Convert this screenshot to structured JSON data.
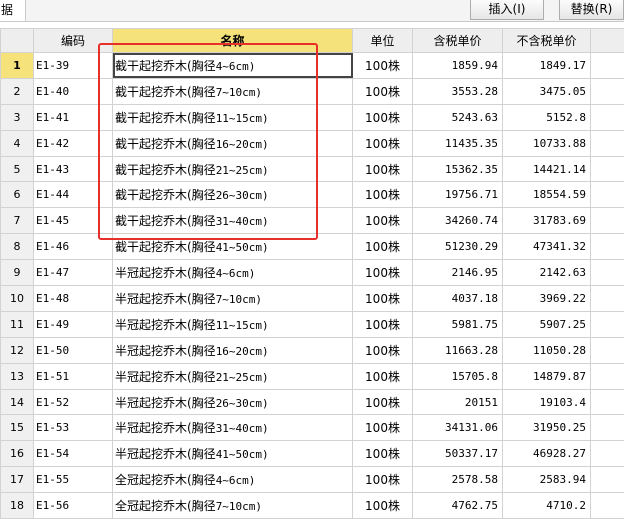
{
  "toolbar": {
    "tab_label": "据",
    "insert_label": "插入(I)",
    "replace_label": "替换(R)"
  },
  "columns": {
    "code": "编码",
    "name": "名称",
    "unit": "单位",
    "price_tax": "含税单价",
    "price_notax": "不含税单价"
  },
  "rows": [
    {
      "n": "1",
      "code": "E1-39",
      "name": "截干起挖乔木(胸径",
      "spec": "4~6cm)",
      "unit": "100株",
      "tax": "1859.94",
      "notax": "1849.17"
    },
    {
      "n": "2",
      "code": "E1-40",
      "name": "截干起挖乔木(胸径",
      "spec": "7~10cm)",
      "unit": "100株",
      "tax": "3553.28",
      "notax": "3475.05"
    },
    {
      "n": "3",
      "code": "E1-41",
      "name": "截干起挖乔木(胸径",
      "spec": "11~15cm)",
      "unit": "100株",
      "tax": "5243.63",
      "notax": "5152.8"
    },
    {
      "n": "4",
      "code": "E1-42",
      "name": "截干起挖乔木(胸径",
      "spec": "16~20cm)",
      "unit": "100株",
      "tax": "11435.35",
      "notax": "10733.88"
    },
    {
      "n": "5",
      "code": "E1-43",
      "name": "截干起挖乔木(胸径",
      "spec": "21~25cm)",
      "unit": "100株",
      "tax": "15362.35",
      "notax": "14421.14"
    },
    {
      "n": "6",
      "code": "E1-44",
      "name": "截干起挖乔木(胸径",
      "spec": "26~30cm)",
      "unit": "100株",
      "tax": "19756.71",
      "notax": "18554.59"
    },
    {
      "n": "7",
      "code": "E1-45",
      "name": "截干起挖乔木(胸径",
      "spec": "31~40cm)",
      "unit": "100株",
      "tax": "34260.74",
      "notax": "31783.69"
    },
    {
      "n": "8",
      "code": "E1-46",
      "name": "截干起挖乔木(胸径",
      "spec": "41~50cm)",
      "unit": "100株",
      "tax": "51230.29",
      "notax": "47341.32"
    },
    {
      "n": "9",
      "code": "E1-47",
      "name": "半冠起挖乔木(胸径",
      "spec": "4~6cm)",
      "unit": "100株",
      "tax": "2146.95",
      "notax": "2142.63"
    },
    {
      "n": "10",
      "code": "E1-48",
      "name": "半冠起挖乔木(胸径",
      "spec": "7~10cm)",
      "unit": "100株",
      "tax": "4037.18",
      "notax": "3969.22"
    },
    {
      "n": "11",
      "code": "E1-49",
      "name": "半冠起挖乔木(胸径",
      "spec": "11~15cm)",
      "unit": "100株",
      "tax": "5981.75",
      "notax": "5907.25"
    },
    {
      "n": "12",
      "code": "E1-50",
      "name": "半冠起挖乔木(胸径",
      "spec": "16~20cm)",
      "unit": "100株",
      "tax": "11663.28",
      "notax": "11050.28"
    },
    {
      "n": "13",
      "code": "E1-51",
      "name": "半冠起挖乔木(胸径",
      "spec": "21~25cm)",
      "unit": "100株",
      "tax": "15705.8",
      "notax": "14879.87"
    },
    {
      "n": "14",
      "code": "E1-52",
      "name": "半冠起挖乔木(胸径",
      "spec": "26~30cm)",
      "unit": "100株",
      "tax": "20151",
      "notax": "19103.4"
    },
    {
      "n": "15",
      "code": "E1-53",
      "name": "半冠起挖乔木(胸径",
      "spec": "31~40cm)",
      "unit": "100株",
      "tax": "34131.06",
      "notax": "31950.25"
    },
    {
      "n": "16",
      "code": "E1-54",
      "name": "半冠起挖乔木(胸径",
      "spec": "41~50cm)",
      "unit": "100株",
      "tax": "50337.17",
      "notax": "46928.27"
    },
    {
      "n": "17",
      "code": "E1-55",
      "name": "全冠起挖乔木(胸径",
      "spec": "4~6cm)",
      "unit": "100株",
      "tax": "2578.58",
      "notax": "2583.94"
    },
    {
      "n": "18",
      "code": "E1-56",
      "name": "全冠起挖乔木(胸径",
      "spec": "7~10cm)",
      "unit": "100株",
      "tax": "4762.75",
      "notax": "4710.2"
    }
  ],
  "colors": {
    "highlight_box": "#e8302a",
    "active_header": "#f5e27a"
  }
}
